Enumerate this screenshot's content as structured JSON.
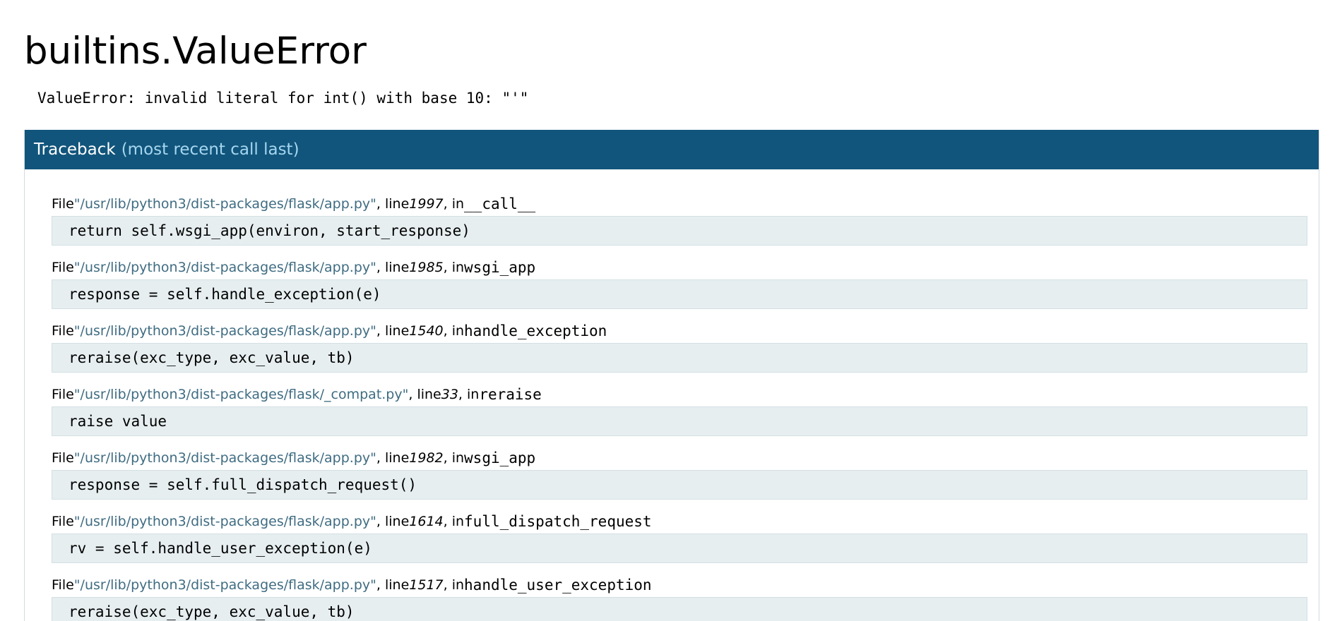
{
  "page": {
    "title": "builtins.ValueError",
    "error_message": "ValueError: invalid literal for int() with base 10: \"'\""
  },
  "traceback": {
    "header_main": "Traceback",
    "header_sub": "(most recent call last)",
    "file_prefix": "File ",
    "line_prefix": ", line ",
    "in_prefix": ", in ",
    "frames": [
      {
        "file": "\"/usr/lib/python3/dist-packages/flask/app.py\"",
        "line": "1997",
        "func": "__call__",
        "source": "return self.wsgi_app(environ, start_response)"
      },
      {
        "file": "\"/usr/lib/python3/dist-packages/flask/app.py\"",
        "line": "1985",
        "func": "wsgi_app",
        "source": "response = self.handle_exception(e)"
      },
      {
        "file": "\"/usr/lib/python3/dist-packages/flask/app.py\"",
        "line": "1540",
        "func": "handle_exception",
        "source": "reraise(exc_type, exc_value, tb)"
      },
      {
        "file": "\"/usr/lib/python3/dist-packages/flask/_compat.py\"",
        "line": "33",
        "func": "reraise",
        "source": "raise value"
      },
      {
        "file": "\"/usr/lib/python3/dist-packages/flask/app.py\"",
        "line": "1982",
        "func": "wsgi_app",
        "source": "response = self.full_dispatch_request()"
      },
      {
        "file": "\"/usr/lib/python3/dist-packages/flask/app.py\"",
        "line": "1614",
        "func": "full_dispatch_request",
        "source": "rv = self.handle_user_exception(e)"
      },
      {
        "file": "\"/usr/lib/python3/dist-packages/flask/app.py\"",
        "line": "1517",
        "func": "handle_user_exception",
        "source": "reraise(exc_type, exc_value, tb)"
      }
    ]
  },
  "colors": {
    "header_bg": "#11557c",
    "header_sub": "#a6d6ef",
    "filename": "#3f6c82",
    "source_bg": "#e6eef0"
  }
}
